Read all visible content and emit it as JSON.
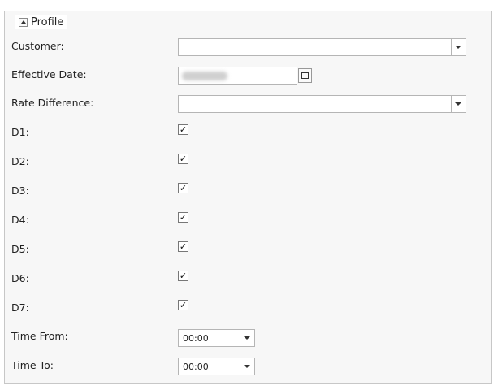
{
  "profile": {
    "legend": "Profile"
  },
  "fields": {
    "customer": {
      "label": "Customer:",
      "value": ""
    },
    "effective_date": {
      "label": "Effective Date:"
    },
    "rate_difference": {
      "label": "Rate Difference:",
      "value": ""
    },
    "days": [
      {
        "label": "D1:",
        "checked": true
      },
      {
        "label": "D2:",
        "checked": true
      },
      {
        "label": "D3:",
        "checked": true
      },
      {
        "label": "D4:",
        "checked": true
      },
      {
        "label": "D5:",
        "checked": true
      },
      {
        "label": "D6:",
        "checked": true
      },
      {
        "label": "D7:",
        "checked": true
      }
    ],
    "time_from": {
      "label": "Time From:",
      "value": "00:00"
    },
    "time_to": {
      "label": "Time To:",
      "value": "00:00"
    }
  },
  "glyphs": {
    "check": "✓"
  },
  "colors": {
    "panel_bg": "#f7f7f7",
    "border": "#c7c7c7"
  }
}
